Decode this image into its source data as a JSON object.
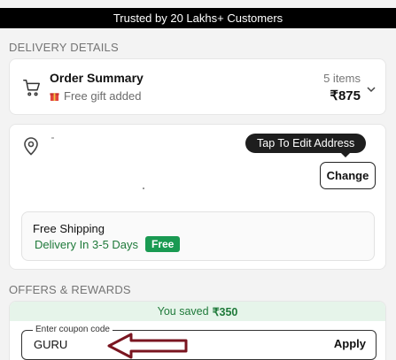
{
  "banner": {
    "text": "Trusted by 20 Lakhs+ Customers"
  },
  "delivery_section": {
    "label": "DELIVERY DETAILS"
  },
  "order_summary": {
    "title": "Order Summary",
    "gift_text": "Free gift added",
    "item_count": "5 items",
    "price": "₹875"
  },
  "address": {
    "tooltip": "Tap To Edit Address",
    "change_label": "Change",
    "shipping_title": "Free Shipping",
    "shipping_eta": "Delivery In 3-5 Days",
    "free_badge": "Free"
  },
  "offers_section": {
    "label": "OFFERS & REWARDS"
  },
  "offers": {
    "saved_prefix": "You saved",
    "saved_amount": "₹350",
    "coupon_legend": "Enter coupon code",
    "coupon_value": "GURU",
    "apply_label": "Apply"
  },
  "colors": {
    "brand_green": "#1a9a52",
    "annotation_arrow": "#7a1520"
  },
  "icons": [
    "cart-icon",
    "gift-icon",
    "chevron-down-icon",
    "location-pin-icon",
    "annotation-arrow-icon"
  ]
}
